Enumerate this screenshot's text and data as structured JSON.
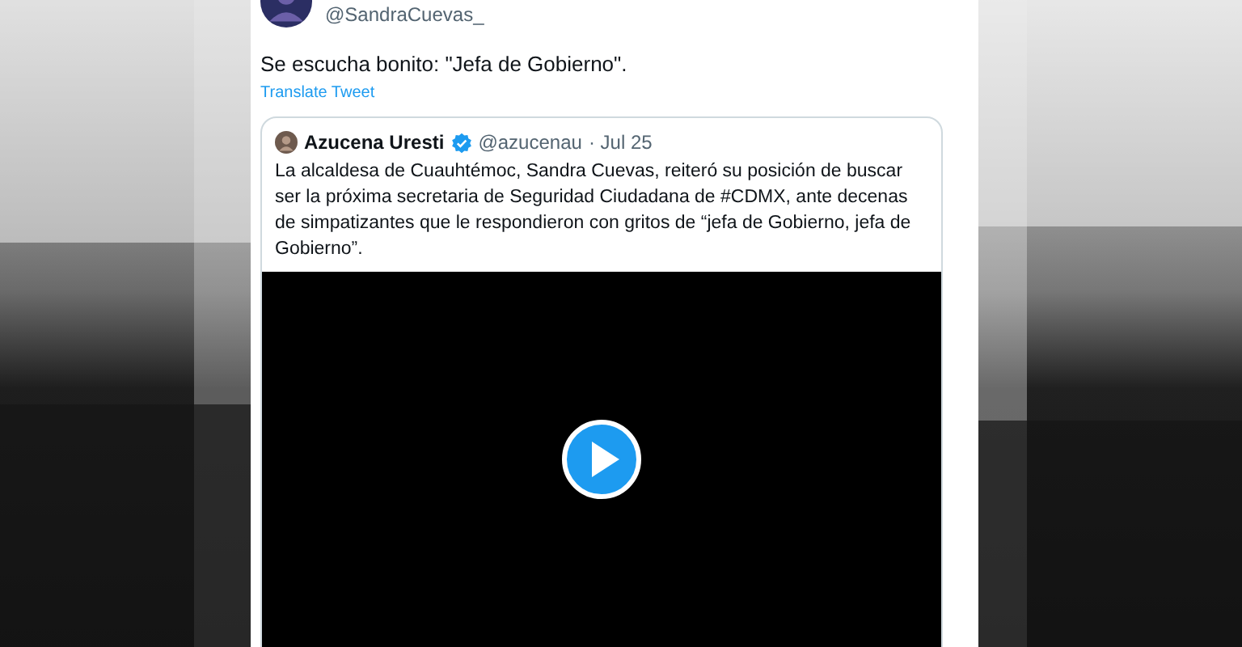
{
  "tweet": {
    "handle": "@SandraCuevas_",
    "text": "Se escucha bonito: \"Jefa de Gobierno\".",
    "translate": "Translate Tweet",
    "quote": {
      "name": "Azucena Uresti",
      "verified": true,
      "handle": "@azucenau",
      "date": "· Jul 25",
      "text": "La alcaldesa de Cuauhtémoc, Sandra Cuevas, reiteró su posición de buscar ser la próxima secretaria de Seguridad Ciudadana de #CDMX, ante decenas de simpatizantes que le respondieron con gritos de “jefa de Gobierno, jefa de Gobierno”.",
      "media": {
        "kind": "video"
      }
    }
  }
}
